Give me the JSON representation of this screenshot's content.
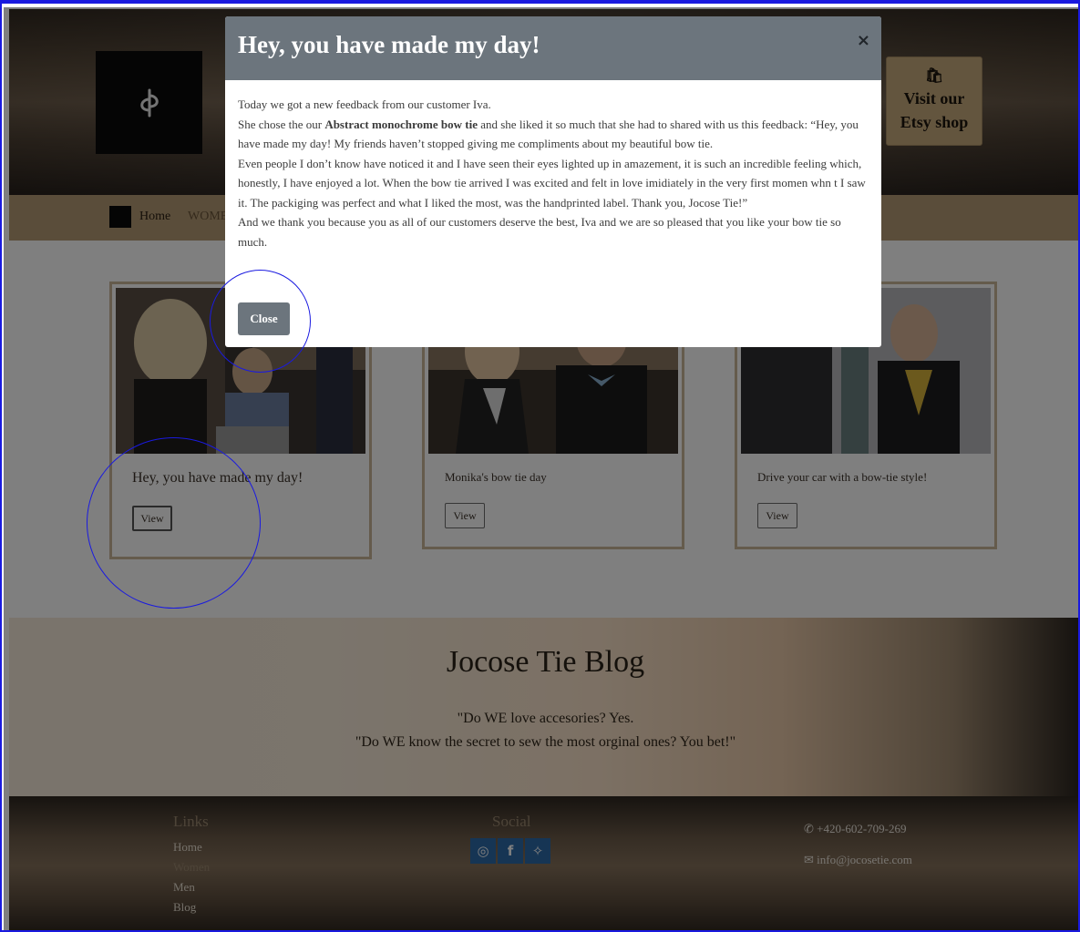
{
  "header": {
    "etsy_icon": "shopping-bag-icon",
    "etsy_line1": "Visit our",
    "etsy_line2": "Etsy shop"
  },
  "breadcrumb": {
    "home": "Home",
    "women": "WOME"
  },
  "cards": [
    {
      "title": "Hey, you have made my day!",
      "view": "View"
    },
    {
      "title": "Monika's bow tie day",
      "view": "View"
    },
    {
      "title": "Drive your car with a bow-tie style!",
      "view": "View"
    }
  ],
  "blog": {
    "title": "Jocose Tie Blog",
    "quote1": "\"Do WE love accesories? Yes.",
    "quote2": "\"Do WE know the secret to sew the most orginal ones? You bet!\""
  },
  "footer": {
    "links_heading": "Links",
    "links": [
      "Home",
      "Women",
      "Men",
      "Blog"
    ],
    "social_heading": "Social",
    "social_icons": [
      "instagram-icon",
      "facebook-icon",
      "twitter-icon"
    ],
    "phone": "+420-602-709-269",
    "email": "info@jocosetie.com"
  },
  "modal": {
    "title": "Hey, you have made my day!",
    "close_x": "×",
    "line1": "Today we got a new feedback from our customer Iva.",
    "line2_pre": "She chose the our ",
    "line2_bold": "Abstract monochrome bow tie",
    "line2_post": " and she liked it so much that she had to shared with us this feedback: “Hey, you have made my day! My friends haven’t stopped giving me compliments about my beautiful bow tie.",
    "line3": "Even people I don’t know have noticed it and I have seen their eyes lighted up in amazement, it is such an incredible feeling which, honestly, I have enjoyed a lot. When the bow tie arrived I was excited and felt in love imidiately in the very first momen whn t I saw it. The packiging was perfect and what I liked the most, was the handprinted label. Thank you, Jocose Tie!”",
    "line4": "And we thank you because you as all of our customers deserve the best, Iva and we are so pleased that you like your bow tie so much.",
    "close_button": "Close"
  }
}
